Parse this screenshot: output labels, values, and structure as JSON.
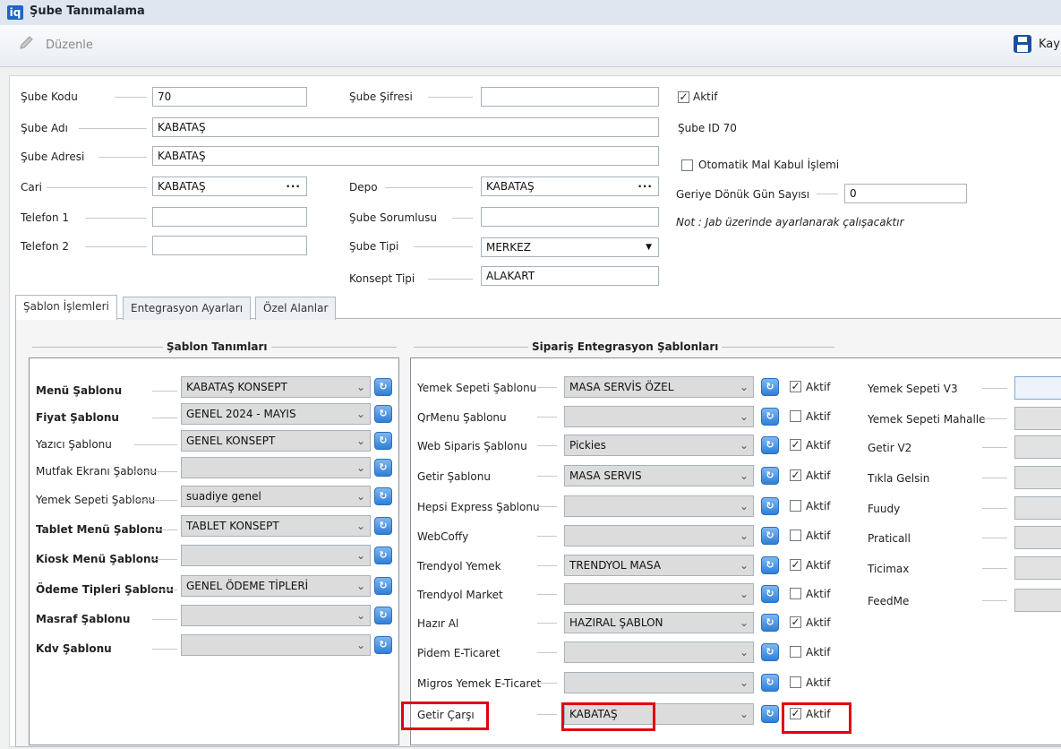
{
  "window": {
    "logo": "iq",
    "title": "Şube Tanımalama"
  },
  "toolbar": {
    "edit_label": "Düzenle",
    "save_label": "Kay"
  },
  "form": {
    "sube_kodu": {
      "label": "Şube Kodu",
      "value": "70"
    },
    "sube_sifresi": {
      "label": "Şube Şifresi",
      "value": ""
    },
    "aktif": {
      "label": "Aktif",
      "checked": true
    },
    "sube_adi": {
      "label": "Şube Adı",
      "value": "KABATAŞ"
    },
    "sube_id": "Şube ID 70",
    "sube_adresi": {
      "label": "Şube Adresi",
      "value": "KABATAŞ"
    },
    "otomatik_mal_kabul": {
      "label": "Otomatik Mal Kabul İşlemi",
      "checked": false
    },
    "cari": {
      "label": "Cari",
      "value": "KABATAŞ",
      "button": "···"
    },
    "depo": {
      "label": "Depo",
      "value": "KABATAŞ",
      "button": "···"
    },
    "geriye_donuk": {
      "label": "Geriye Dönük Gün Sayısı",
      "value": "0"
    },
    "telefon1": {
      "label": "Telefon 1",
      "value": ""
    },
    "sube_sorumlusu": {
      "label": "Şube Sorumlusu",
      "value": ""
    },
    "note": "Not : Jab üzerinde ayarlanarak çalışacaktır",
    "telefon2": {
      "label": "Telefon 2",
      "value": ""
    },
    "sube_tipi": {
      "label": "Şube Tipi",
      "value": "MERKEZ"
    },
    "konsept_tipi": {
      "label": "Konsept Tipi",
      "value": "ALAKART"
    }
  },
  "tabs": [
    {
      "label": "Şablon İşlemleri",
      "active": true
    },
    {
      "label": "Entegrasyon Ayarları",
      "active": false
    },
    {
      "label": "Özel Alanlar",
      "active": false
    }
  ],
  "sablon_tanimlari": {
    "title": "Şablon Tanımları",
    "rows": [
      {
        "label": "Menü Şablonu",
        "bold": true,
        "value": "KABATAŞ KONSEPT"
      },
      {
        "label": "Fiyat Şablonu",
        "bold": true,
        "value": "GENEL 2024 - MAYIS"
      },
      {
        "label": "Yazıcı Şablonu",
        "bold": false,
        "value": "GENEL KONSEPT"
      },
      {
        "label": "Mutfak Ekranı Şablonu",
        "bold": false,
        "value": ""
      },
      {
        "label": "Yemek Sepeti Şablonu",
        "bold": false,
        "value": "suadiye genel"
      },
      {
        "label": "Tablet Menü Şablonu",
        "bold": true,
        "value": "TABLET KONSEPT"
      },
      {
        "label": "Kiosk Menü Şablonu",
        "bold": true,
        "value": ""
      },
      {
        "label": "Ödeme Tipleri Şablonu",
        "bold": true,
        "value": "GENEL ÖDEME TİPLERİ"
      },
      {
        "label": "Masraf Şablonu",
        "bold": true,
        "value": ""
      },
      {
        "label": "Kdv Şablonu",
        "bold": true,
        "value": ""
      }
    ]
  },
  "siparis_entegrasyon": {
    "title": "Sipariş Entegrasyon Şablonları",
    "aktif_label": "Aktif",
    "rows": [
      {
        "label": "Yemek Sepeti Şablonu",
        "value": "MASA SERVİS ÖZEL",
        "aktif": true
      },
      {
        "label": "QrMenu Şablonu",
        "value": "",
        "aktif": false
      },
      {
        "label": "Web Siparis Şablonu",
        "value": "Pickies",
        "aktif": true
      },
      {
        "label": "Getir Şablonu",
        "value": "MASA SERVIS",
        "aktif": true
      },
      {
        "label": "Hepsi Express Şablonu",
        "value": "",
        "aktif": false
      },
      {
        "label": "WebCoffy",
        "value": "",
        "aktif": false
      },
      {
        "label": "Trendyol Yemek",
        "value": "TRENDYOL MASA",
        "aktif": true
      },
      {
        "label": "Trendyol Market",
        "value": "",
        "aktif": false
      },
      {
        "label": "Hazır Al",
        "value": "HAZIRAL ŞABLON",
        "aktif": true
      },
      {
        "label": "Pidem E-Ticaret",
        "value": "",
        "aktif": false
      },
      {
        "label": "Migros Yemek E-Ticaret",
        "value": "",
        "aktif": false
      },
      {
        "label": "Getir Çarşı",
        "value": "KABATAŞ",
        "aktif": true
      }
    ]
  },
  "right_integrations": [
    "Yemek Sepeti V3",
    "Yemek Sepeti Mahalle",
    "Getir V2",
    "Tıkla Gelsin",
    "Fuudy",
    "Praticall",
    "Ticimax",
    "FeedMe"
  ],
  "icons": {
    "edit": "pencil-icon",
    "save": "save-disk-icon",
    "refresh": "refresh-icon",
    "dropdown": "chevron-down-icon",
    "ellipsis": "ellipsis-icon",
    "check": "check-icon"
  },
  "colors": {
    "highlight": "#e00010",
    "accent": "#2f7fd6"
  }
}
